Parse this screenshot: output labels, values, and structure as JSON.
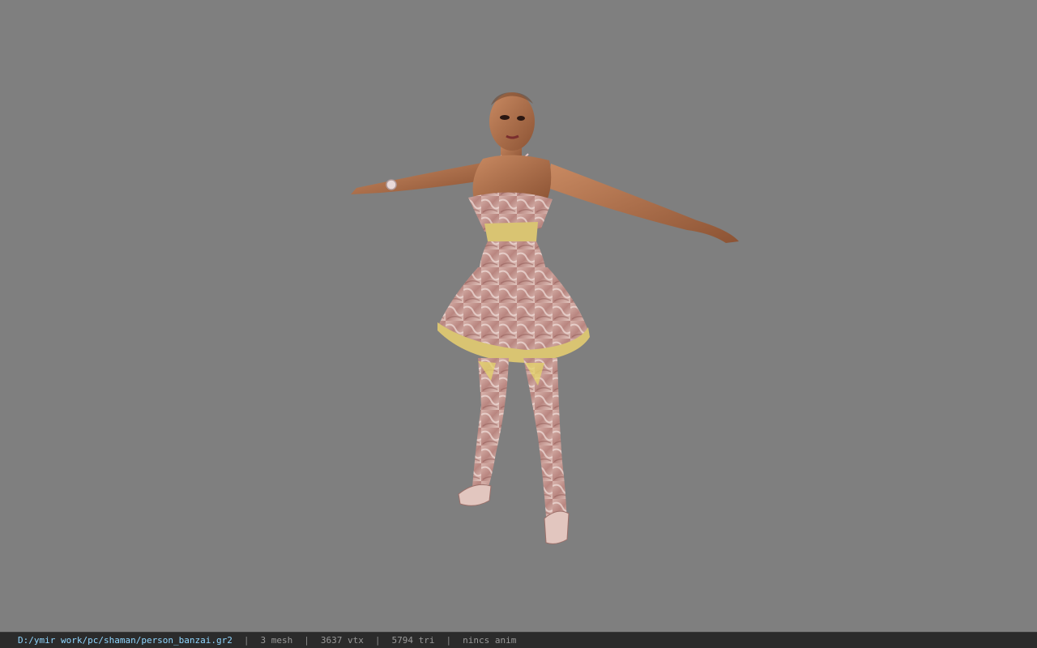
{
  "viewer": {
    "background_color": "#7f7f7f",
    "statusbar": {
      "file_path": "D:/ymir work/pc/shaman/person_banzai.gr2",
      "mesh_count": "3 mesh",
      "vertex_count": "3637 vtx",
      "triangle_count": "5794 tri",
      "anim": "nincs anim",
      "separator": "|",
      "path_color": "#8fd6ff"
    },
    "model": {
      "name": "3d-character-model",
      "pose": "T-pose",
      "dress_color": "#c9a09a",
      "trim_color": "#d9c472",
      "skin_color": "#b9734d"
    }
  }
}
